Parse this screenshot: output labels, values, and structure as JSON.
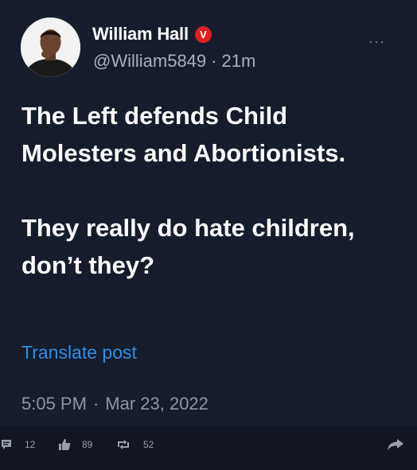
{
  "author": {
    "name": "William Hall",
    "badge_letter": "V",
    "handle": "@William5849",
    "separator": "·",
    "time_ago": "21m"
  },
  "more_label": "···",
  "post": {
    "paragraph1": "The Left defends Child Molesters and Abortionists.",
    "paragraph2": "They really do hate children, don’t they?"
  },
  "translate_label": "Translate post",
  "meta": {
    "time": "5:05 PM",
    "separator": "·",
    "date": "Mar 23, 2022"
  },
  "actions": {
    "comments": "12",
    "likes": "89",
    "reposts": "52"
  },
  "icons": {
    "comment": "comment-icon",
    "like": "thumbs-up-icon",
    "repost": "repost-icon",
    "share": "share-icon"
  },
  "colors": {
    "background": "#151d2c",
    "link": "#2f8ee6",
    "badge": "#e02020"
  }
}
